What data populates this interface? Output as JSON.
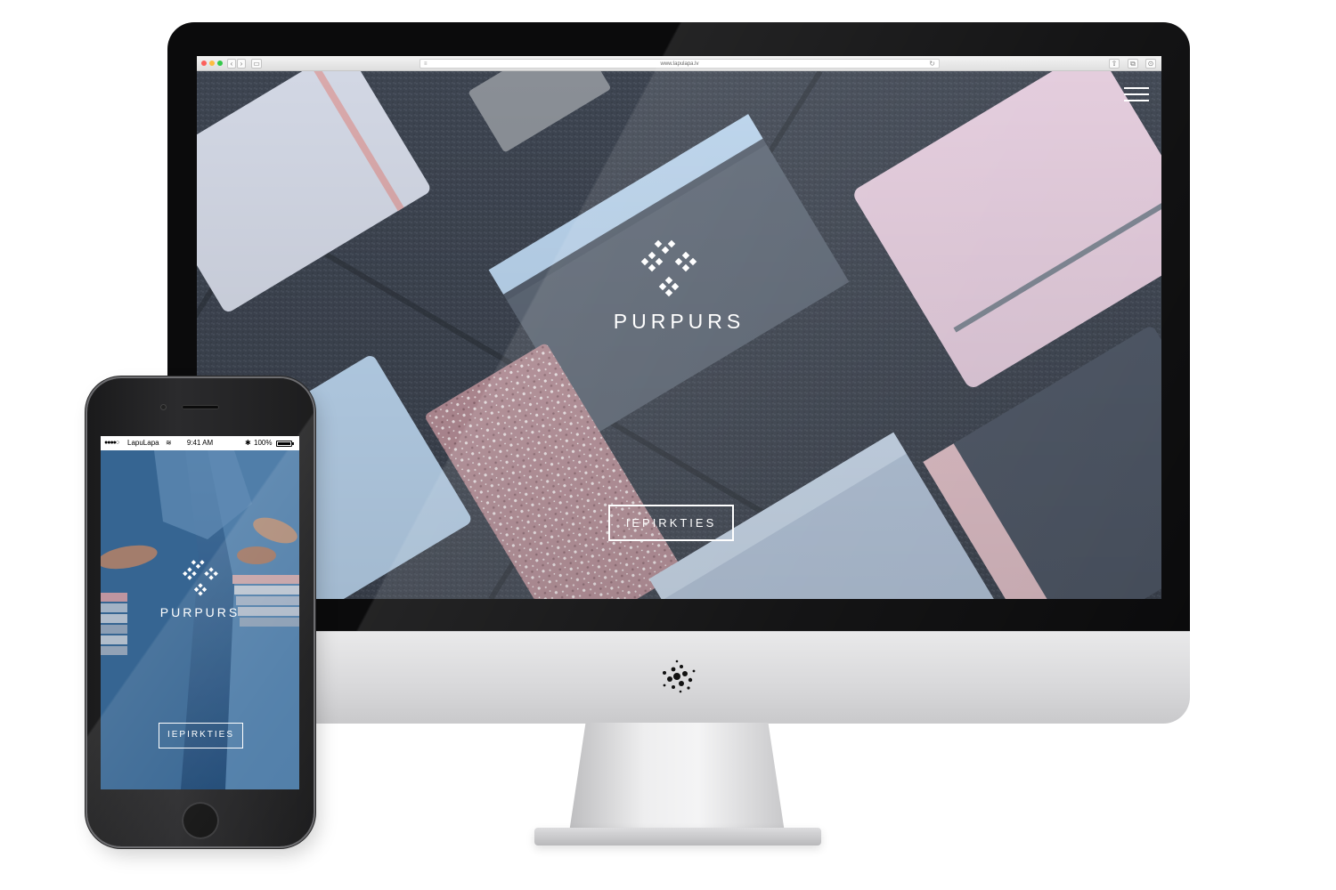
{
  "desktop": {
    "browser": {
      "url": "www.lapulapa.lv",
      "toolbar": {
        "back_glyph": "‹",
        "forward_glyph": "›",
        "sidebar_glyph": "▭",
        "reader_glyph": "≡",
        "reload_glyph": "↻",
        "share_glyph": "⇧",
        "tabs_glyph": "⧉",
        "extra_glyph": "⊙"
      }
    },
    "page": {
      "brand_name": "PURPURS",
      "cta_label": "IEPIRKTIES",
      "menu_icon": "hamburger-menu-icon"
    }
  },
  "mobile": {
    "status_bar": {
      "signal": "●●●●○",
      "carrier": "LapuLapa",
      "wifi_glyph": "≋",
      "time": "9:41 AM",
      "bluetooth_glyph": "✱",
      "battery": "100%"
    },
    "page": {
      "brand_name": "PURPURS",
      "cta_label": "IEPIRKTIES"
    }
  },
  "colors": {
    "device_black": "#0b0b0c",
    "aluminum": "#d8d8da",
    "hero_slate": "#3e4550",
    "notebook_pink": "#e3cbdc",
    "notebook_blue": "#b9d3ec",
    "mobile_denim": "#2f5d8e",
    "accent_white": "#ffffff"
  }
}
